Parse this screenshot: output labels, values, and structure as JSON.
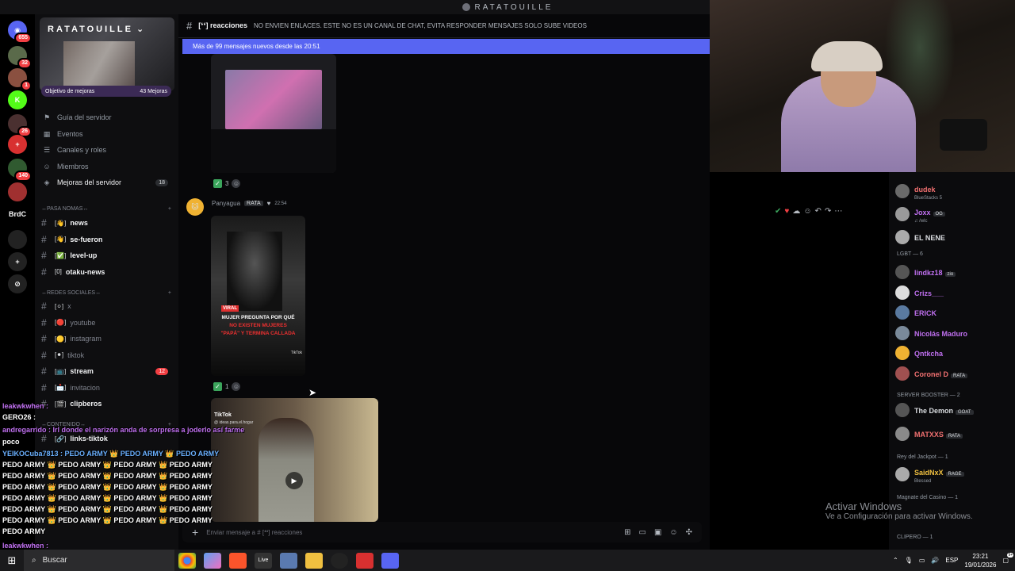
{
  "window": {
    "title": "RATATOUILLE"
  },
  "servers": [
    {
      "badge": "655",
      "color": "#5865f2",
      "glyph": "◉"
    },
    {
      "badge": "32",
      "color": "#5a6a4a",
      "glyph": ""
    },
    {
      "badge": "1",
      "color": "#8a5040",
      "glyph": ""
    },
    {
      "badge": "",
      "color": "#53fc18",
      "glyph": "K"
    },
    {
      "badge": "26",
      "color": "#4a3030",
      "glyph": ""
    },
    {
      "badge": "",
      "color": "#d83030",
      "glyph": "+"
    },
    {
      "badge": "140",
      "color": "#305a30",
      "glyph": ""
    },
    {
      "badge": "",
      "color": "#a03030",
      "glyph": ""
    },
    {
      "badge": "",
      "color": "#000000",
      "glyph": "BrdC"
    },
    {
      "badge": "",
      "color": "#222",
      "glyph": ""
    },
    {
      "badge": "",
      "color": "#222",
      "glyph": "+"
    },
    {
      "badge": "",
      "color": "#222",
      "glyph": "⊘"
    }
  ],
  "sidebar": {
    "server_name": "RATATOUILLE",
    "boost": {
      "label": "Objetivo de mejoras",
      "count": "43 Mejoras"
    },
    "nav": [
      {
        "label": "Guía del servidor",
        "icon": "signpost-icon"
      },
      {
        "label": "Eventos",
        "icon": "calendar-icon"
      },
      {
        "label": "Canales y roles",
        "icon": "list-icon"
      },
      {
        "label": "Miembros",
        "icon": "members-icon"
      },
      {
        "label": "Mejoras del servidor",
        "icon": "boost-icon",
        "badge": "18"
      }
    ],
    "categories": [
      {
        "label": "↔PASA NOMAS↔"
      },
      {
        "label": "↔REDES SOCIALES↔"
      },
      {
        "label": "↔CONTENIDO↔"
      }
    ],
    "channels_a": [
      {
        "emoji": "[👋]",
        "label": "news"
      },
      {
        "emoji": "[👋]",
        "label": "se-fueron"
      },
      {
        "emoji": "[✅]",
        "label": "level-up"
      },
      {
        "emoji": "[0]",
        "label": "otaku-news"
      }
    ],
    "channels_b": [
      {
        "emoji": "[⚪]",
        "label": "x",
        "bright": false
      },
      {
        "emoji": "[🔴]",
        "label": "youtube",
        "bright": false
      },
      {
        "emoji": "[🟡]",
        "label": "instagram",
        "bright": false
      },
      {
        "emoji": "[⚫]",
        "label": "tiktok",
        "bright": false
      },
      {
        "emoji": "[📺]",
        "label": "stream",
        "bright": true,
        "badge": "12"
      },
      {
        "emoji": "[📩]",
        "label": "invitacion",
        "bright": false
      },
      {
        "emoji": "[🎬]",
        "label": "clipberos",
        "bright": true
      }
    ],
    "channels_c": [
      {
        "emoji": "[🔗]",
        "label": "links-tiktok"
      }
    ]
  },
  "chat": {
    "channel_name": "[❛❛] reacciones",
    "topic": "NO ENVIEN ENLACES. ESTE NO ES UN CANAL DE CHAT, EVITA RESPONDER MENSAJES SOLO SUBE VIDEOS",
    "new_messages": "Más de 99 mensajes nuevos desde las 20:51",
    "reaction1_count": "3",
    "reaction2_count": "1",
    "author": {
      "name": "Panyagua",
      "tag": "RATA",
      "time": "22:54"
    },
    "video1": {
      "badge": "VIRAL",
      "line1": "MUJER PREGUNTA POR QUÉ",
      "line2": "NO EXISTEN MUJERES",
      "line3": "\"PAPÁ\" Y TERMINA CALLADA",
      "brand": "TikTok"
    },
    "video2": {
      "brand": "TikTok",
      "handle": "@ ideas.para.el.hogar"
    },
    "composer_placeholder": "Enviar mensaje a # [❛❛] reacciones"
  },
  "members": {
    "rows": [
      {
        "name": "dudek",
        "sub": "BlueStacks 5",
        "color": "#f07070",
        "av": "#6a6a6a"
      },
      {
        "name": "Joxx",
        "sub": "♫ /wlc",
        "color": "#c070f0",
        "av": "#9a9a9a",
        "tag": "OG"
      },
      {
        "name": "EL NENE",
        "sub": "",
        "color": "#dbdee1",
        "av": "#aaaaaa"
      }
    ],
    "group_lgbt": "LGBT — 6",
    "lgbt": [
      {
        "name": "lindkz18",
        "color": "#c070f0",
        "av": "#555",
        "tag": "zio"
      },
      {
        "name": "Crizs___",
        "color": "#c070f0",
        "av": "#ddd"
      },
      {
        "name": "ERICK",
        "color": "#c070f0",
        "av": "#5a7aa0"
      },
      {
        "name": "Nicolás Maduro",
        "color": "#c070f0",
        "av": "#7a8a9a"
      },
      {
        "name": "Qntkcha",
        "color": "#c070f0",
        "av": "#f0b232"
      },
      {
        "name": "Coronel D",
        "color": "#f07070",
        "av": "#a05050",
        "tag": "RATA"
      }
    ],
    "group_booster": "SERVER BOOSTER — 2",
    "booster": [
      {
        "name": "The Demon",
        "color": "#dbdee1",
        "av": "#555",
        "tag": "GOAT"
      },
      {
        "name": "MATXXS",
        "color": "#f07070",
        "av": "#8a8a8a",
        "tag": "RATA"
      }
    ],
    "group_jackpot": "Rey del Jackpot — 1",
    "jackpot": [
      {
        "name": "SaidNxX",
        "sub": "Blessed",
        "color": "#f0c040",
        "av": "#aaaaaa",
        "tag": "RAGE"
      }
    ],
    "group_casino": "Magnate del Casino — 1",
    "group_clipero": "CLIPERO — 1"
  },
  "overlay": [
    {
      "text": "leakwkwhen :",
      "color": "#c070f0"
    },
    {
      "text": "GERO26 :",
      "color": "#ffffff"
    },
    {
      "text": "andregarrido : lrl donde el narizón anda de sorpresa a joderlo así farme",
      "color": "#c070f0"
    },
    {
      "text": "poco",
      "color": "#ffffff"
    },
    {
      "text": "YEIKOCuba7813 : PEDO ARMY 👑 PEDO ARMY 👑 PEDO ARMY",
      "color": "#6ab0ff"
    },
    {
      "text": "PEDO ARMY 👑 PEDO ARMY 👑 PEDO ARMY 👑 PEDO ARMY",
      "color": "#ffffff"
    },
    {
      "text": "PEDO ARMY 👑 PEDO ARMY 👑 PEDO ARMY 👑 PEDO ARMY",
      "color": "#ffffff"
    },
    {
      "text": "PEDO ARMY 👑 PEDO ARMY 👑 PEDO ARMY 👑 PEDO ARMY",
      "color": "#ffffff"
    },
    {
      "text": "PEDO ARMY 👑 PEDO ARMY 👑 PEDO ARMY 👑 PEDO ARMY",
      "color": "#ffffff"
    },
    {
      "text": "PEDO ARMY 👑 PEDO ARMY 👑 PEDO ARMY 👑 PEDO ARMY",
      "color": "#ffffff"
    },
    {
      "text": "PEDO ARMY 👑 PEDO ARMY 👑 PEDO ARMY 👑 PEDO ARMY",
      "color": "#ffffff"
    },
    {
      "text": "PEDO ARMY",
      "color": "#ffffff"
    },
    {
      "text": "leakwkwhen :",
      "color": "#c070f0"
    }
  ],
  "watermark": {
    "title": "Activar Windows",
    "sub": "Ve a Configuración para activar Windows."
  },
  "taskbar": {
    "search": "Buscar",
    "lang": "ESP",
    "time": "23:21",
    "date": "19/01/2026",
    "notif": "9+"
  }
}
